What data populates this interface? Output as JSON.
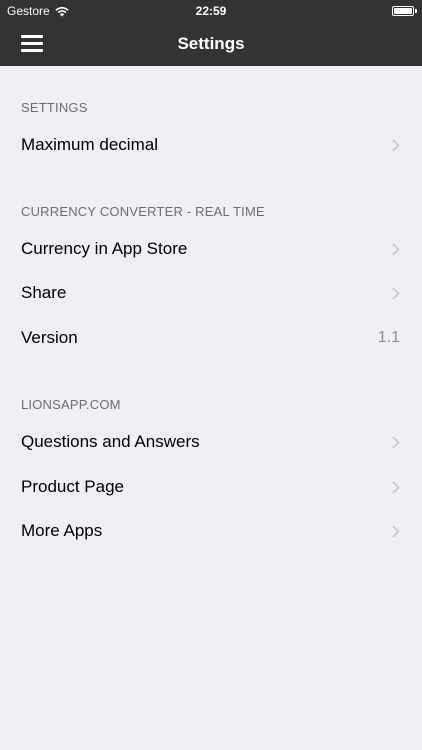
{
  "status_bar": {
    "carrier": "Gestore",
    "time": "22:59"
  },
  "nav": {
    "title": "Settings"
  },
  "sections": [
    {
      "header": "SETTINGS",
      "rows": [
        {
          "label": "Maximum decimal",
          "accessory": "chevron"
        }
      ]
    },
    {
      "header": "CURRENCY CONVERTER - REAL TIME",
      "rows": [
        {
          "label": "Currency in App Store",
          "accessory": "chevron"
        },
        {
          "label": "Share",
          "accessory": "chevron"
        },
        {
          "label": "Version",
          "value": "1.1"
        }
      ]
    },
    {
      "header": "LIONSAPP.COM",
      "rows": [
        {
          "label": "Questions and Answers",
          "accessory": "chevron"
        },
        {
          "label": "Product Page",
          "accessory": "chevron"
        },
        {
          "label": "More Apps",
          "accessory": "chevron"
        }
      ]
    }
  ],
  "colors": {
    "bar_background": "#333333",
    "page_background": "#efeff4",
    "section_header": "#6d6d72",
    "secondary_text": "#8e8e93",
    "chevron": "#c7c7cc"
  }
}
